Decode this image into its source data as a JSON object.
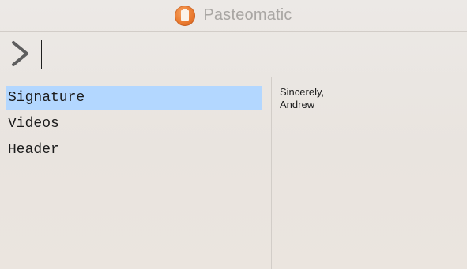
{
  "app": {
    "title": "Pasteomatic",
    "icon": "clipboard-app-icon"
  },
  "search": {
    "value": "",
    "prompt_icon": "chevron-right-icon"
  },
  "snippets": [
    {
      "label": "Signature",
      "selected": true
    },
    {
      "label": "Videos",
      "selected": false
    },
    {
      "label": "Header",
      "selected": false
    }
  ],
  "preview": {
    "lines": [
      "Sincerely,",
      "Andrew"
    ]
  },
  "colors": {
    "selection": "#b3d7ff",
    "app_icon": "#ea7a2f",
    "title_text": "#a9a6a3"
  }
}
